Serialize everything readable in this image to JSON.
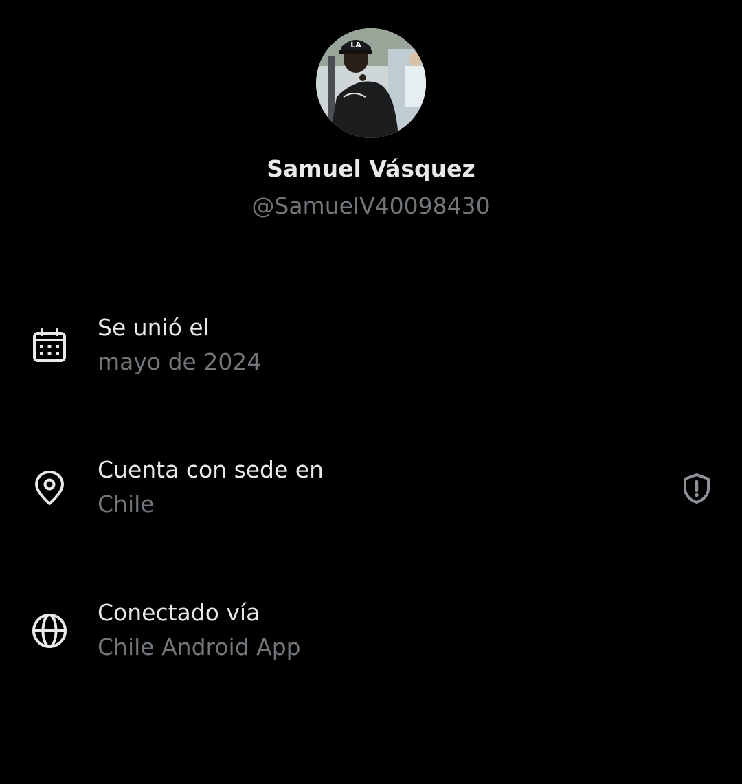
{
  "profile": {
    "display_name": "Samuel Vásquez",
    "handle": "@SamuelV40098430"
  },
  "about": {
    "joined": {
      "icon": "calendar-icon",
      "label": "Se unió el",
      "value": "mayo de 2024"
    },
    "location": {
      "icon": "location-pin-icon",
      "label": "Cuenta con sede en",
      "value": "Chile",
      "badge_icon": "shield-alert-icon"
    },
    "connected": {
      "icon": "globe-icon",
      "label": "Conectado vía",
      "value": "Chile Android App"
    }
  },
  "colors": {
    "background": "#000000",
    "primary_text": "#e7e9ea",
    "secondary_text": "#71767b"
  }
}
